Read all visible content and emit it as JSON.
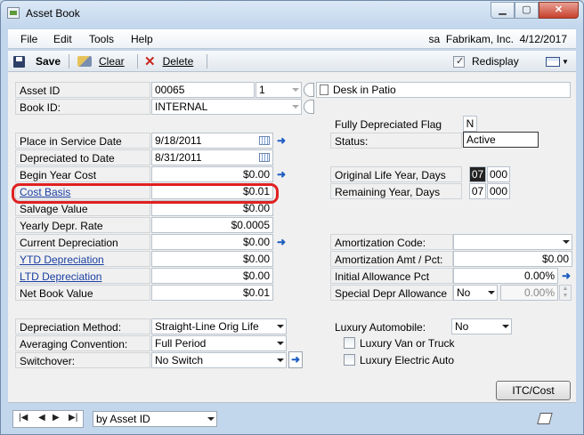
{
  "window": {
    "title": "Asset Book"
  },
  "menubar": {
    "file": "File",
    "edit": "Edit",
    "tools": "Tools",
    "help": "Help",
    "user": "sa",
    "company": "Fabrikam, Inc.",
    "date": "4/12/2017"
  },
  "toolbar": {
    "save": "Save",
    "clear": "Clear",
    "delete": "Delete",
    "redisplay": "Redisplay",
    "redisplay_checked": true
  },
  "asset": {
    "id_label": "Asset ID",
    "id": "00065",
    "suffix": "1",
    "description": "Desk in Patio",
    "book_label": "Book ID:",
    "book": "INTERNAL"
  },
  "left": {
    "place_in_service_label": "Place in Service Date",
    "place_in_service": "9/18/2011",
    "depreciated_to_label": "Depreciated to Date",
    "depreciated_to": "8/31/2011",
    "begin_year_cost_label": "Begin Year Cost",
    "begin_year_cost": "$0.00",
    "cost_basis_label": "Cost Basis",
    "cost_basis": "$0.01",
    "salvage_label": "Salvage Value",
    "salvage": "$0.00",
    "yearly_label": "Yearly Depr. Rate",
    "yearly": "$0.0005",
    "current_label": "Current Depreciation",
    "current": "$0.00",
    "ytd_label": "YTD Depreciation",
    "ytd": "$0.00",
    "ltd_label": "LTD Depreciation",
    "ltd": "$0.00",
    "nbv_label": "Net Book Value",
    "nbv": "$0.01",
    "method_label": "Depreciation Method:",
    "method": "Straight-Line Orig Life",
    "convention_label": "Averaging Convention:",
    "convention": "Full Period",
    "switchover_label": "Switchover:",
    "switchover": "No Switch"
  },
  "right": {
    "fully_flag_label": "Fully Depreciated Flag",
    "fully_flag": "N",
    "status_label": "Status:",
    "status": "Active",
    "orig_life_label": "Original Life Year, Days",
    "orig_life_year": "07",
    "orig_life_days": "000",
    "remaining_label": "Remaining Year, Days",
    "remaining_year": "07",
    "remaining_days": "000",
    "amort_code_label": "Amortization Code:",
    "amort_code": "",
    "amort_amt_label": "Amortization Amt / Pct:",
    "amort_amt": "$0.00",
    "initial_allow_label": "Initial Allowance Pct",
    "initial_allow": "0.00%",
    "special_allow_label": "Special Depr Allowance",
    "special_allow_select": "No",
    "special_allow_pct": "0.00%",
    "luxury_label": "Luxury Automobile:",
    "luxury": "No",
    "van_label": "Luxury Van or Truck",
    "electric_label": "Luxury Electric Auto",
    "itc_button": "ITC/Cost"
  },
  "statusbar": {
    "sort": "by Asset ID"
  }
}
